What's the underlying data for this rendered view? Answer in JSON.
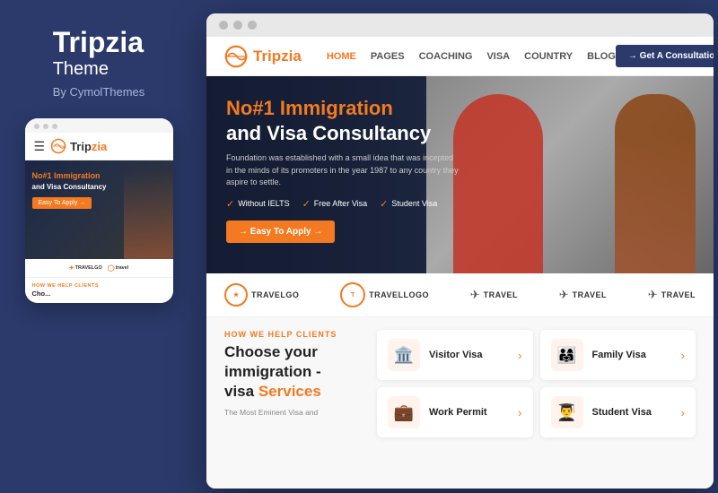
{
  "left_panel": {
    "brand_name": "Tripzia",
    "brand_sub": "Theme",
    "brand_by": "By CymolThemes"
  },
  "mobile_preview": {
    "logo_text_main": "Trip",
    "logo_text_accent": "zia",
    "hero_heading_line1": "No#1 Immigration",
    "hero_heading_line2": "and Visa Consultancy",
    "hero_btn": "Easy To Apply →",
    "section_label": "HOW WE HELP CLIENTS",
    "section_heading": "Cho..."
  },
  "browser": {
    "nav": {
      "logo_main": "Trip",
      "logo_accent": "zia",
      "links": [
        "HOME",
        "PAGES",
        "COACHING",
        "VISA",
        "COUNTRY",
        "BLOG"
      ],
      "active_link": "HOME",
      "cta_btn": "→ Get A Consultation!"
    },
    "hero": {
      "title_orange": "No#1 Immigration",
      "title_white": "and Visa Consultancy",
      "description": "Foundation was established with a small idea that was incepted in the minds of its promoters in the year 1987 to any country they aspire to settle.",
      "features": [
        "Without IELTS",
        "Free After Visa",
        "Student Visa"
      ],
      "apply_btn": "→ Easy To Apply →"
    },
    "logos": [
      {
        "text": "TRAVELGO",
        "type": "with-circle"
      },
      {
        "text": "Travellogo",
        "type": "circle-border"
      },
      {
        "text": "travel",
        "type": "with-plane"
      },
      {
        "text": "Travel",
        "type": "with-plane"
      },
      {
        "text": "travel",
        "type": "with-plane-small"
      }
    ],
    "services": {
      "label": "HOW WE HELP CLIENTS",
      "heading_line1": "Choose your",
      "heading_line2": "immigration -",
      "heading_line3": "visa",
      "heading_accent": "Services",
      "subdesc": "The Most Eminent Visa and",
      "cards": [
        {
          "name": "Visitor Visa",
          "icon": "🏛️"
        },
        {
          "name": "Family Visa",
          "icon": "👨‍👩‍👧"
        },
        {
          "name": "Work Permit",
          "icon": "💼"
        },
        {
          "name": "Student Visa",
          "icon": "👨‍🎓"
        }
      ]
    }
  }
}
